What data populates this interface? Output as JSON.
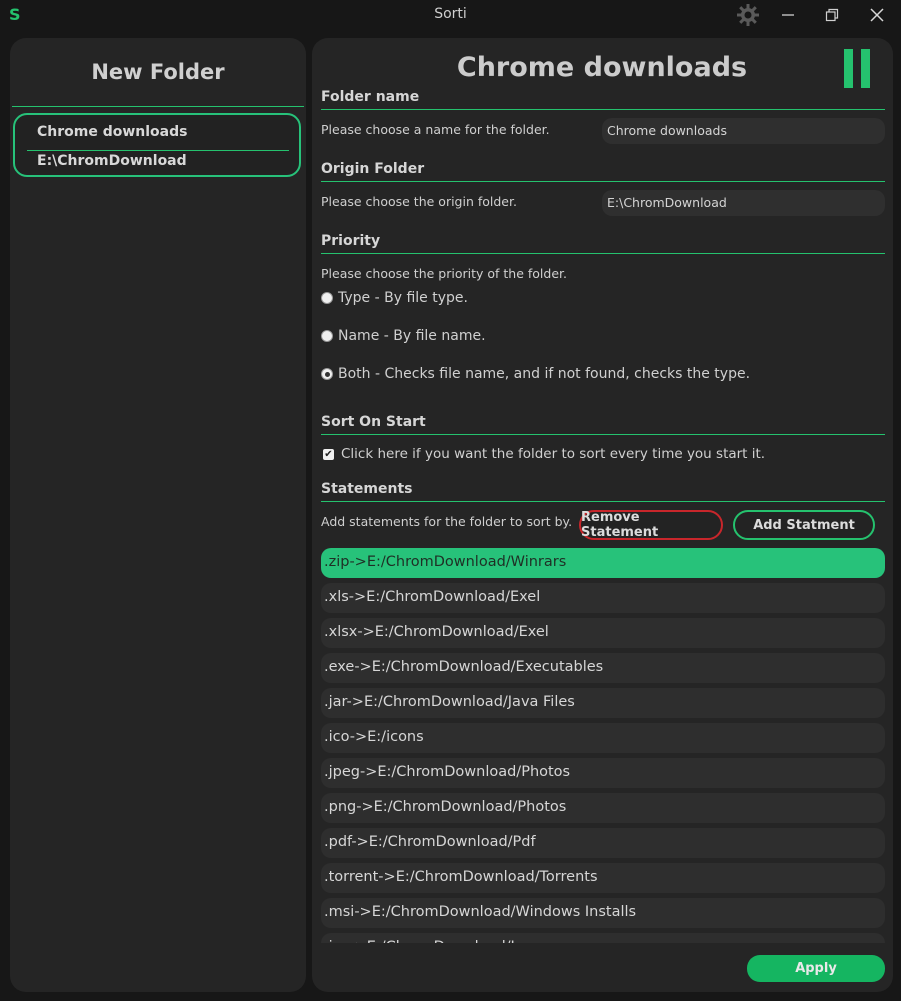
{
  "window": {
    "logo": "S",
    "title": "Sorti",
    "settings_icon": "gear-icon",
    "minimize_icon": "minimize-icon",
    "maximize_icon": "restore-icon",
    "close_icon": "close-icon"
  },
  "sidebar": {
    "title": "New Folder",
    "folders": [
      {
        "name": "Chrome downloads",
        "path": "E:\\ChromDownload"
      }
    ]
  },
  "main": {
    "title": "Chrome downloads",
    "pause_icon": "pause-icon",
    "folder_name": {
      "heading": "Folder name",
      "description": "Please choose a name for the folder.",
      "value": "Chrome downloads"
    },
    "origin_folder": {
      "heading": "Origin Folder",
      "description": "Please choose the origin folder.",
      "value": "E:\\ChromDownload"
    },
    "priority": {
      "heading": "Priority",
      "description": "Please choose the priority of the folder.",
      "options": [
        {
          "label": "Type - By file type.",
          "checked": false
        },
        {
          "label": "Name - By file name.",
          "checked": false
        },
        {
          "label": "Both - Checks file name, and if not found, checks the type.",
          "checked": true
        }
      ]
    },
    "sort_on_start": {
      "heading": "Sort On Start",
      "label": "Click here if you want the folder to sort every time you start it.",
      "checked": true
    },
    "statements": {
      "heading": "Statements",
      "description": "Add statements for the folder to sort by.",
      "remove_label": "Remove Statement",
      "add_label": "Add Statment",
      "items": [
        ".zip->E:/ChromDownload/Winrars",
        ".xls->E:/ChromDownload/Exel",
        ".xlsx->E:/ChromDownload/Exel",
        ".exe->E:/ChromDownload/Executables",
        ".jar->E:/ChromDownload/Java Files",
        ".ico->E:/icons",
        ".jpeg->E:/ChromDownload/Photos",
        ".png->E:/ChromDownload/Photos",
        ".pdf->E:/ChromDownload/Pdf",
        ".torrent->E:/ChromDownload/Torrents",
        ".msi->E:/ChromDownload/Windows Installs",
        ".iso->E:/ChromDownload/Isos"
      ],
      "selected_index": 0
    },
    "apply_label": "Apply"
  },
  "colors": {
    "accent": "#25c26e",
    "selected_row": "#27c27a",
    "danger": "#c8262b",
    "panel": "#252525",
    "background": "#171717"
  }
}
